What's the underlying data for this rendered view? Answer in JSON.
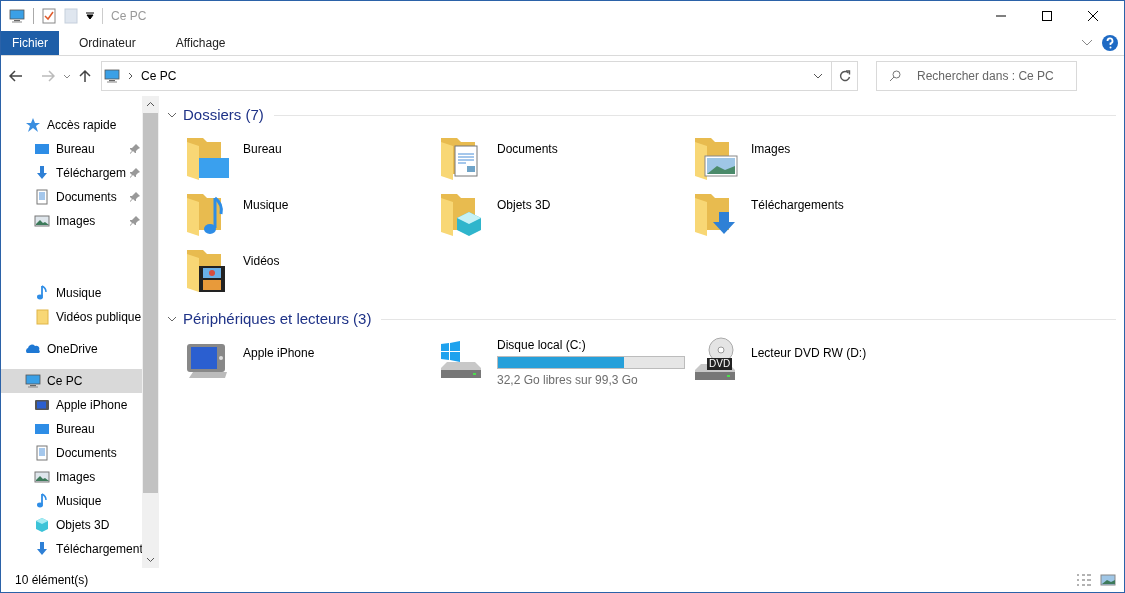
{
  "window": {
    "title": "Ce PC"
  },
  "ribbon_tabs": [
    {
      "label": "Fichier",
      "selected": true
    },
    {
      "label": "Ordinateur",
      "selected": false
    },
    {
      "label": "Affichage",
      "selected": false
    }
  ],
  "address": {
    "path": "Ce PC"
  },
  "search": {
    "placeholder": "Rechercher dans : Ce PC"
  },
  "sidebar": {
    "groups": [
      {
        "label": "Accès rapide",
        "selected": false,
        "children": [
          {
            "label": "Bureau",
            "pinned": true,
            "selected": false
          },
          {
            "label": "Téléchargem",
            "pinned": true,
            "selected": false
          },
          {
            "label": "Documents",
            "pinned": true,
            "selected": false
          },
          {
            "label": "Images",
            "pinned": true,
            "selected": false
          }
        ]
      },
      {
        "children": [
          {
            "label": "Musique",
            "pinned": false,
            "selected": false
          },
          {
            "label": "Vidéos publique",
            "pinned": false,
            "selected": false
          }
        ]
      },
      {
        "label": "OneDrive",
        "selected": false
      },
      {
        "label": "Ce PC",
        "selected": true,
        "children": [
          {
            "label": "Apple iPhone",
            "selected": false
          },
          {
            "label": "Bureau",
            "selected": false
          },
          {
            "label": "Documents",
            "selected": false
          },
          {
            "label": "Images",
            "selected": false
          },
          {
            "label": "Musique",
            "selected": false
          },
          {
            "label": "Objets 3D",
            "selected": false
          },
          {
            "label": "Téléchargement",
            "selected": false
          }
        ]
      }
    ]
  },
  "sections": [
    {
      "title": "Dossiers (7)",
      "expanded": true,
      "items": [
        {
          "name": "Bureau"
        },
        {
          "name": "Documents"
        },
        {
          "name": "Images"
        },
        {
          "name": "Musique"
        },
        {
          "name": "Objets 3D"
        },
        {
          "name": "Téléchargements"
        },
        {
          "name": "Vidéos"
        }
      ]
    },
    {
      "title": "Périphériques et lecteurs (3)",
      "expanded": true,
      "items": [
        {
          "name": "Apple iPhone",
          "kind": "device"
        },
        {
          "name": "Disque local (C:)",
          "kind": "drive",
          "level": 0.68,
          "free": "32,2 Go libres sur 99,3 Go"
        },
        {
          "name": "Lecteur DVD RW (D:)",
          "kind": "dvd",
          "badge": "DVD"
        }
      ]
    }
  ],
  "status_bar": {
    "count": "10 élément(s)"
  }
}
